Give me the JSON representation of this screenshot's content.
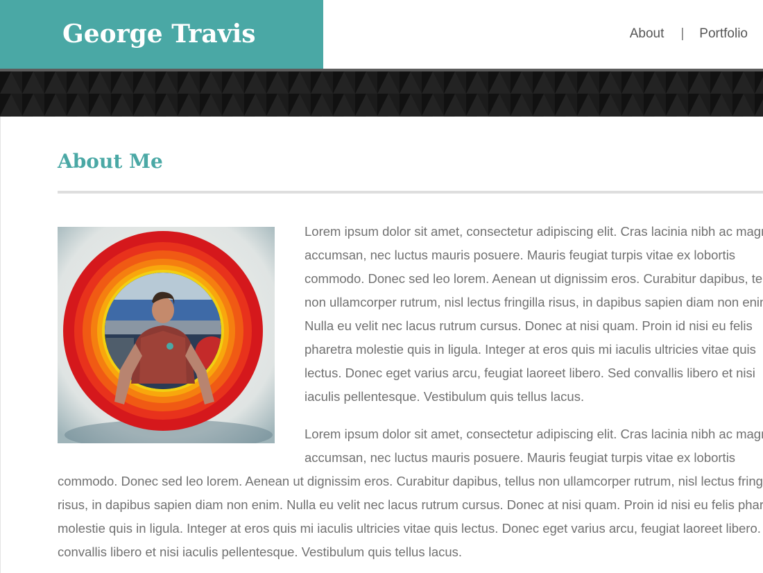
{
  "site": {
    "brand_name": "George Travis",
    "colors": {
      "brand_teal": "#4aa8a5",
      "text_gray": "#707070",
      "pattern_dark": "#161616"
    }
  },
  "nav": {
    "items": [
      {
        "label": "About"
      },
      {
        "label": "Portfolio"
      }
    ],
    "separator": "|"
  },
  "main": {
    "section_title": "About Me",
    "profile_image": {
      "icon": "profile-photo"
    },
    "paragraphs": [
      "Lorem ipsum dolor sit amet, consectetur adipiscing elit. Cras lacinia nibh ac magna accumsan, nec luctus mauris posuere. Mauris feugiat turpis vitae ex lobortis commodo. Donec sed leo lorem. Aenean ut dignissim eros. Curabitur dapibus, tellus non ullamcorper rutrum, nisl lectus fringilla risus, in dapibus sapien diam non enim. Nulla eu velit nec lacus rutrum cursus. Donec at nisi quam. Proin id nisi eu felis pharetra molestie quis in ligula. Integer at eros quis mi iaculis ultricies vitae quis lectus. Donec eget varius arcu, feugiat laoreet libero. Sed convallis libero et nisi iaculis pellentesque. Vestibulum quis tellus lacus.",
      "Lorem ipsum dolor sit amet, consectetur adipiscing elit. Cras lacinia nibh ac magna accumsan, nec luctus mauris posuere. Mauris feugiat turpis vitae ex lobortis commodo. Donec sed leo lorem. Aenean ut dignissim eros. Curabitur dapibus, tellus non ullamcorper rutrum, nisl lectus fringilla risus, in dapibus sapien diam non enim. Nulla eu velit nec lacus rutrum cursus. Donec at nisi quam. Proin id nisi eu felis pharetra molestie quis in ligula. Integer at eros quis mi iaculis ultricies vitae quis lectus. Donec eget varius arcu, feugiat laoreet libero. Sed convallis libero et nisi iaculis pellentesque. Vestibulum quis tellus lacus."
    ]
  }
}
